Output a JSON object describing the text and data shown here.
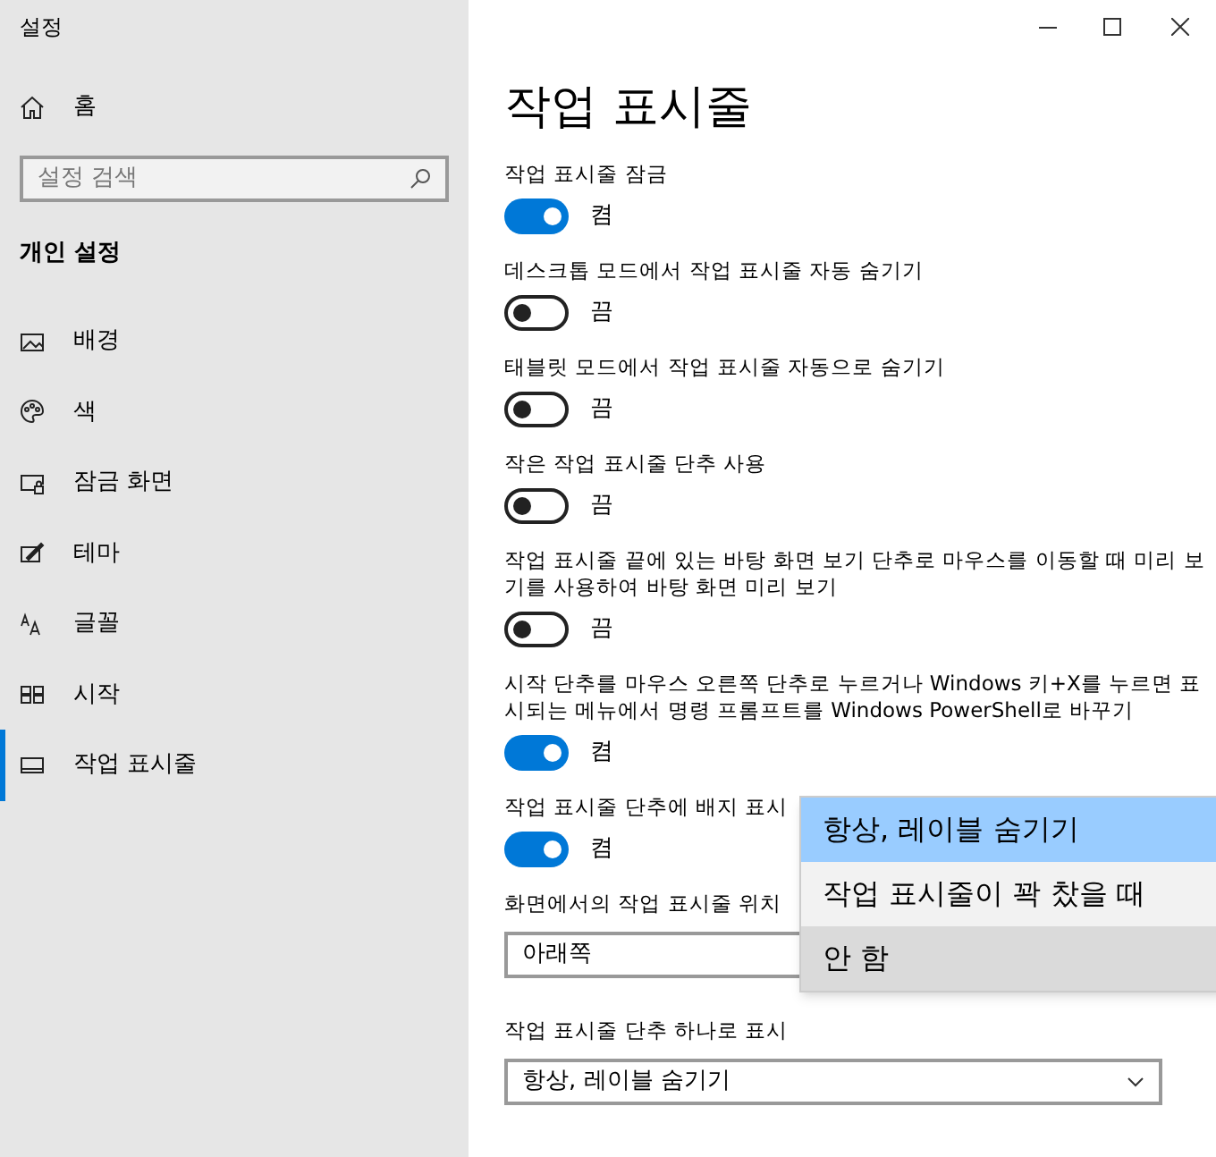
{
  "window": {
    "title": "설정"
  },
  "sidebar": {
    "home": "홈",
    "search": {
      "placeholder": "설정 검색"
    },
    "section": "개인 설정",
    "items": [
      {
        "label": "배경",
        "selected": false
      },
      {
        "label": "색",
        "selected": false
      },
      {
        "label": "잠금 화면",
        "selected": false
      },
      {
        "label": "테마",
        "selected": false
      },
      {
        "label": "글꼴",
        "selected": false
      },
      {
        "label": "시작",
        "selected": false
      },
      {
        "label": "작업 표시줄",
        "selected": true
      }
    ]
  },
  "page": {
    "title": "작업 표시줄",
    "settings": [
      {
        "kind": "toggle",
        "label": "작업 표시줄 잠금",
        "on": true,
        "state": "켬"
      },
      {
        "kind": "toggle",
        "label": "데스크톱 모드에서 작업 표시줄 자동 숨기기",
        "on": false,
        "state": "끔"
      },
      {
        "kind": "toggle",
        "label": "태블릿 모드에서 작업 표시줄 자동으로 숨기기",
        "on": false,
        "state": "끔"
      },
      {
        "kind": "toggle",
        "label": "작은 작업 표시줄 단추 사용",
        "on": false,
        "state": "끔"
      },
      {
        "kind": "toggle",
        "label": "작업 표시줄 끝에 있는 바탕 화면 보기 단추로 마우스를 이동할 때 미리 보기를 사용하여 바탕 화면 미리 보기",
        "on": false,
        "state": "끔"
      },
      {
        "kind": "toggle",
        "label": "시작 단추를 마우스 오른쪽 단추로 누르거나 Windows 키+X를 누르면 표시되는 메뉴에서 명령 프롬프트를 Windows PowerShell로 바꾸기",
        "on": true,
        "state": "켬"
      },
      {
        "kind": "toggle",
        "label": "작업 표시줄 단추에 배지 표시",
        "on": true,
        "state": "켬"
      },
      {
        "kind": "select",
        "label": "화면에서의 작업 표시줄 위치",
        "value": "아래쪽"
      },
      {
        "kind": "select",
        "label": "작업 표시줄 단추 하나로 표시",
        "value": "항상, 레이블 숨기기"
      }
    ]
  },
  "open_menu": {
    "items": [
      {
        "label": "항상, 레이블 숨기기",
        "selected": true,
        "hovered": false
      },
      {
        "label": "작업 표시줄이 꽉 찼을 때",
        "selected": false,
        "hovered": false
      },
      {
        "label": "안 함",
        "selected": false,
        "hovered": true
      }
    ]
  }
}
